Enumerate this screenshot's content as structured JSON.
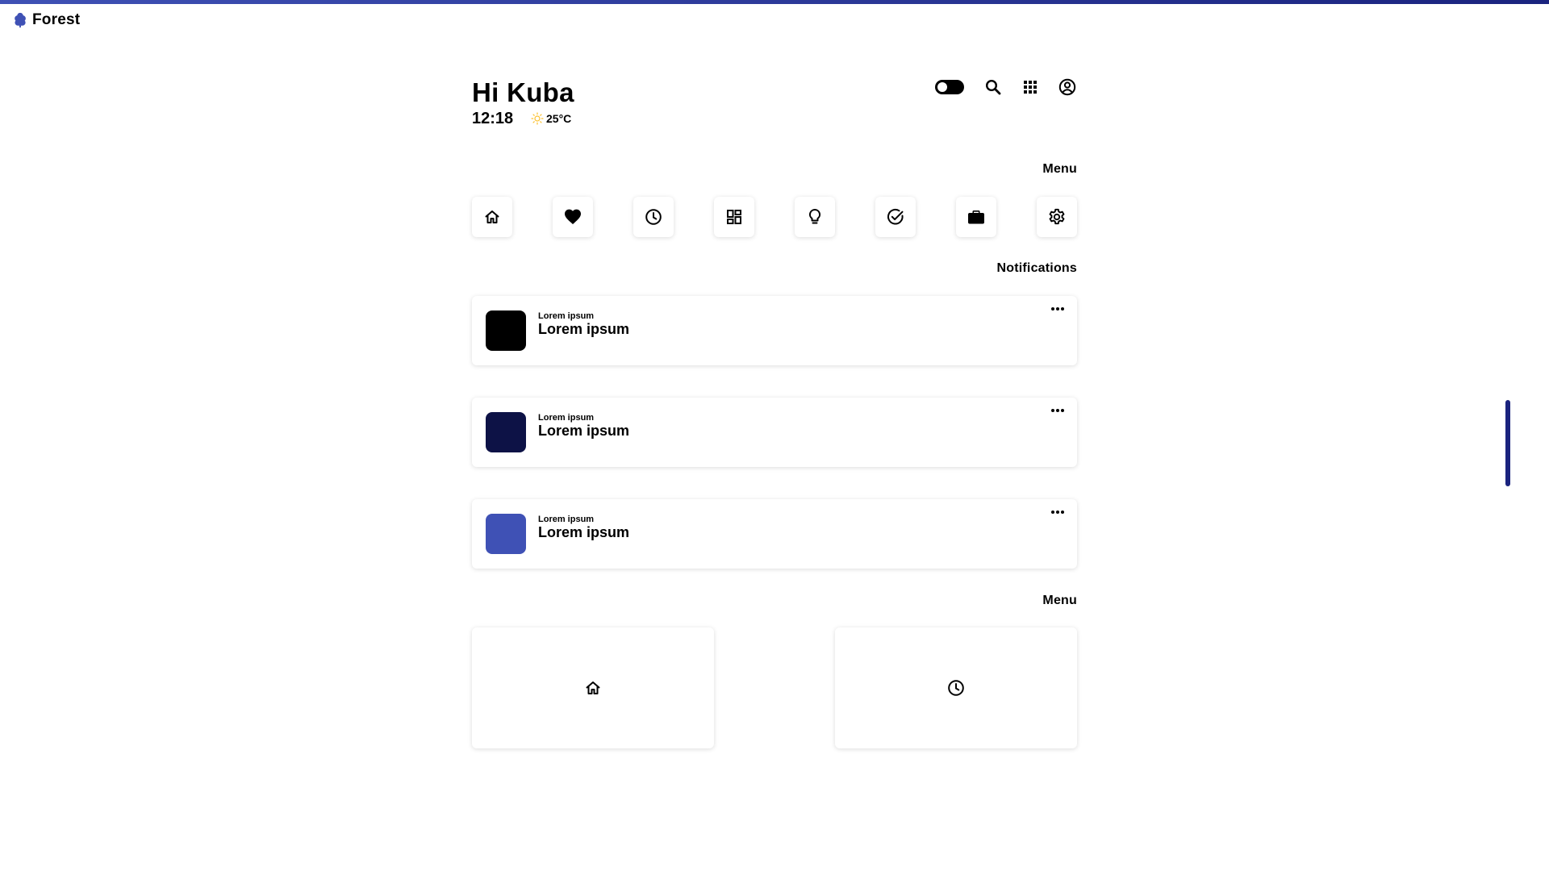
{
  "brand": {
    "name": "Forest",
    "icon": "tree-icon",
    "color": "#3f51b5"
  },
  "accent": {
    "primary": "#3f51b5",
    "dark": "#1a237e"
  },
  "header": {
    "greeting": "Hi Kuba",
    "time": "12:18",
    "weather": {
      "icon": "sun-icon",
      "temperature": "25°C",
      "icon_color": "#fbc02d"
    },
    "actions": [
      "theme-toggle",
      "search-icon",
      "apps-grid-icon",
      "account-icon"
    ]
  },
  "menu_title": "Menu",
  "menu_items": [
    "home-icon",
    "heart-icon",
    "clock-icon",
    "dashboard-icon",
    "lightbulb-icon",
    "check-circle-icon",
    "briefcase-icon",
    "gear-icon"
  ],
  "notifications_title": "Notifications",
  "notifications": [
    {
      "subtitle": "Lorem ipsum",
      "title": "Lorem ipsum",
      "color": "#000000"
    },
    {
      "subtitle": "Lorem ipsum",
      "title": "Lorem ipsum",
      "color": "#0d1246"
    },
    {
      "subtitle": "Lorem ipsum",
      "title": "Lorem ipsum",
      "color": "#3f51b5"
    }
  ],
  "bottom_menu_title": "Menu",
  "tiles": [
    "home-icon",
    "clock-icon"
  ]
}
